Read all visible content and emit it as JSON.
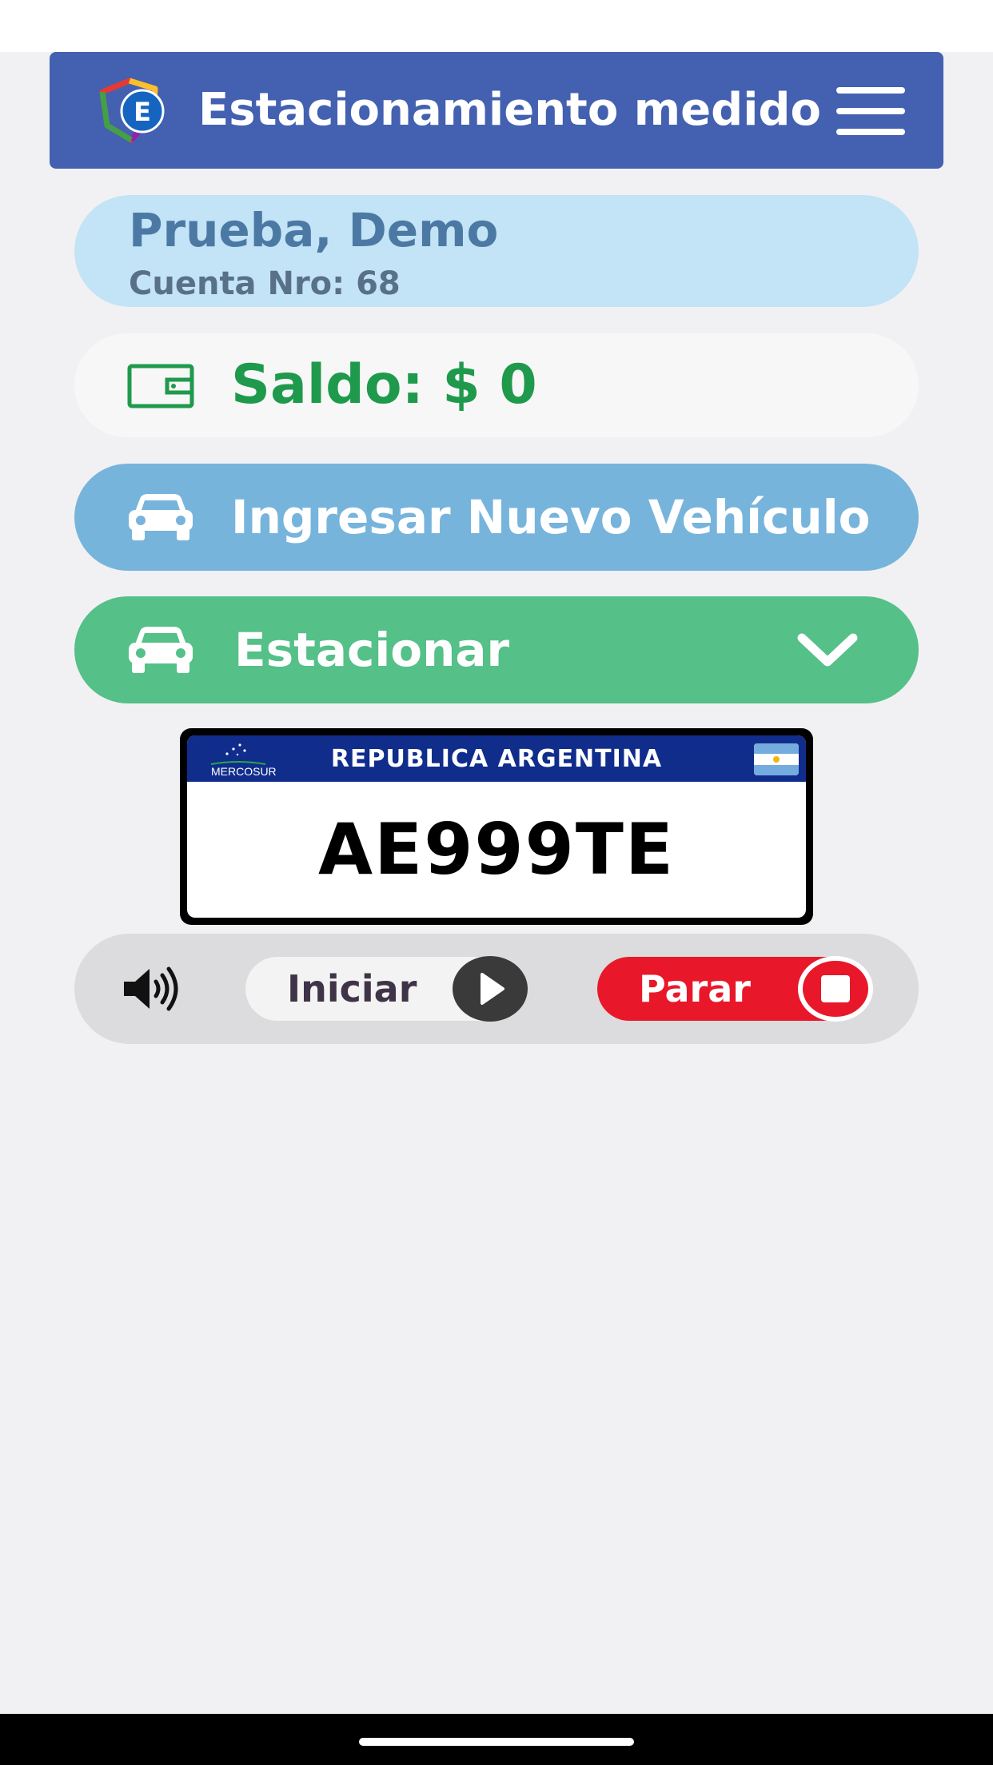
{
  "header": {
    "title": "Estacionamiento medido",
    "logo_letter": "E",
    "menu_icon": "hamburger-menu-icon",
    "color": "#4361b0"
  },
  "user": {
    "name": "Prueba, Demo",
    "account": "Cuenta Nro: 68"
  },
  "balance": {
    "icon": "wallet-icon",
    "text": "Saldo: $ 0",
    "color": "#1f9a4c"
  },
  "actions": {
    "new_vehicle": {
      "label": "Ingresar Nuevo Vehículo",
      "icon": "car-icon",
      "color": "#77b4dc"
    },
    "park": {
      "label": "Estacionar",
      "icon": "car-icon",
      "toggle_icon": "chevron-down-icon",
      "color": "#55c088"
    }
  },
  "plate": {
    "country": "REPUBLICA ARGENTINA",
    "bloc": "MERCOSUR",
    "number": "AE999TE",
    "flag_icon": "argentina-flag-icon"
  },
  "controls": {
    "speaker_icon": "speaker-icon",
    "start_label": "Iniciar",
    "start_icon": "play-icon",
    "stop_label": "Parar",
    "stop_icon": "stop-icon",
    "stop_color": "#e8182a"
  }
}
